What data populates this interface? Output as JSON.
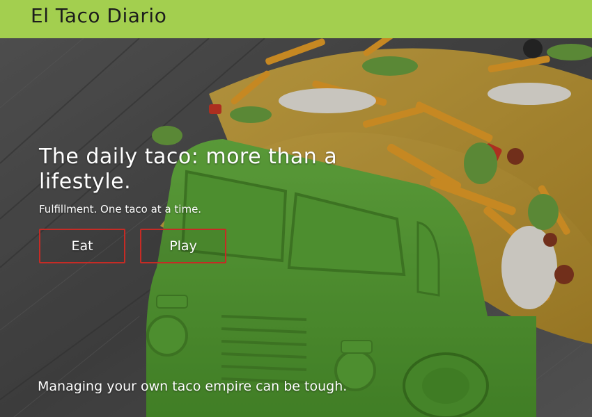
{
  "header": {
    "brand": "El Taco Diario"
  },
  "hero": {
    "headline": "The daily taco: more than a lifestyle.",
    "tagline": "Fulfillment. One taco at a time.",
    "buttons": {
      "eat_label": "Eat",
      "play_label": "Play"
    },
    "footer_text": "Managing your own taco empire can be tough."
  },
  "colors": {
    "header_bg": "#a3cf4f",
    "button_border": "#c62b25",
    "truck_green": "#5aa63a",
    "shell": "#c9a23c"
  }
}
